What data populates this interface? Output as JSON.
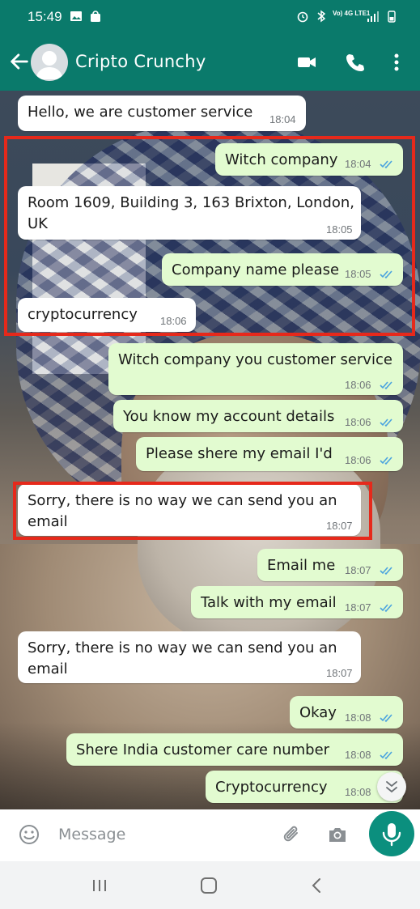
{
  "status_bar": {
    "time": "15:49",
    "signal_text": "Vo) 4G LTE1"
  },
  "header": {
    "contact_name": "Cripto Crunchy"
  },
  "messages": [
    {
      "dir": "in",
      "text": "Hello, we are customer service",
      "time": "18:04"
    },
    {
      "dir": "out",
      "text": "Witch company",
      "time": "18:04"
    },
    {
      "dir": "in",
      "text": "Room 1609, Building 3, 163 Brixton, London, UK",
      "time": "18:05"
    },
    {
      "dir": "out",
      "text": "Company name please",
      "time": "18:05"
    },
    {
      "dir": "in",
      "text": "cryptocurrency",
      "time": "18:06"
    },
    {
      "dir": "out",
      "text": "Witch company you customer service",
      "time": "18:06"
    },
    {
      "dir": "out",
      "text": "You know my account details",
      "time": "18:06"
    },
    {
      "dir": "out",
      "text": "Please shere my email I'd",
      "time": "18:06"
    },
    {
      "dir": "in",
      "text": "Sorry, there is no way we can send you an email",
      "time": "18:07"
    },
    {
      "dir": "out",
      "text": "Email me",
      "time": "18:07"
    },
    {
      "dir": "out",
      "text": "Talk with my email",
      "time": "18:07"
    },
    {
      "dir": "in",
      "text": "Sorry, there is no way we can send you an email",
      "time": "18:07"
    },
    {
      "dir": "out",
      "text": "Okay",
      "time": "18:08"
    },
    {
      "dir": "out",
      "text": "Shere India customer care number",
      "time": "18:08"
    },
    {
      "dir": "out",
      "text": "Cryptocurrency",
      "time": "18:08"
    }
  ],
  "composer": {
    "placeholder": "Message"
  },
  "colors": {
    "header": "#0a7a6b",
    "outgoing": "#e2fbd0",
    "incoming": "#ffffff",
    "highlight": "#e6291b",
    "mic": "#0b8f7e",
    "read_tick": "#4aa3df"
  },
  "icons": [
    "back-arrow-icon",
    "video-call-icon",
    "phone-icon",
    "more-icon",
    "emoji-icon",
    "attach-icon",
    "camera-icon",
    "mic-icon",
    "scroll-down-icon",
    "recents-icon",
    "home-icon",
    "back-icon"
  ]
}
